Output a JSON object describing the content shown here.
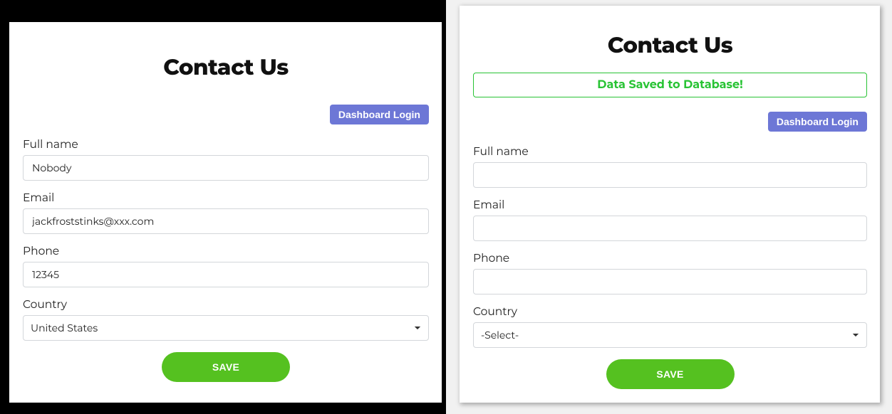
{
  "left": {
    "title": "Contact Us",
    "login_label": "Dashboard Login",
    "fullname_label": "Full name",
    "fullname_value": "Nobody",
    "email_label": "Email",
    "email_value": "jackfroststinks@xxx.com",
    "phone_label": "Phone",
    "phone_value": "12345",
    "country_label": "Country",
    "country_value": "United States",
    "save_label": "SAVE"
  },
  "right": {
    "title": "Contact Us",
    "alert_text": "Data Saved to Database!",
    "login_label": "Dashboard Login",
    "fullname_label": "Full name",
    "fullname_value": "",
    "email_label": "Email",
    "email_value": "",
    "phone_label": "Phone",
    "phone_value": "",
    "country_label": "Country",
    "country_value": "-Select-",
    "save_label": "SAVE"
  }
}
